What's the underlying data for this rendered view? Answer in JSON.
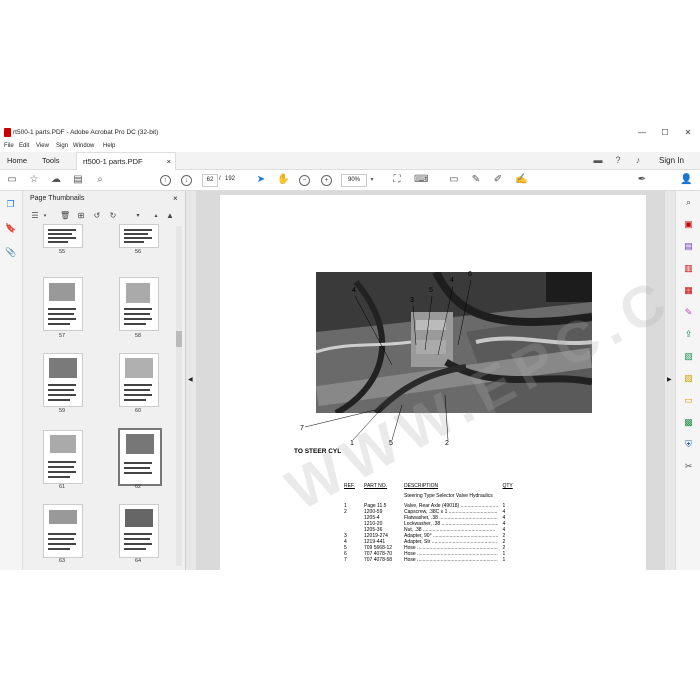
{
  "window": {
    "title": "rt500-1 parts.PDF - Adobe Acrobat Pro DC (32-bit)",
    "controls": [
      "—",
      "☐",
      "✕"
    ]
  },
  "menu": [
    "File",
    "Edit",
    "View",
    "Sign",
    "Window",
    "Help"
  ],
  "tabs": {
    "home": "Home",
    "tools": "Tools",
    "document": "rt500-1 parts.PDF",
    "close": "×",
    "sign_in": "Sign In"
  },
  "toolbar": {
    "current_page": "62",
    "page_separator": "/",
    "total_pages": "192",
    "zoom": "90%"
  },
  "panel": {
    "title": "Page Thumbnails",
    "close": "×",
    "thumbnails": [
      {
        "label": "55"
      },
      {
        "label": "56"
      },
      {
        "label": "57"
      },
      {
        "label": "58"
      },
      {
        "label": "59"
      },
      {
        "label": "60"
      },
      {
        "label": "61"
      },
      {
        "label": "62"
      },
      {
        "label": "63"
      },
      {
        "label": "64"
      }
    ]
  },
  "document": {
    "callouts": [
      "4",
      "3",
      "5",
      "4",
      "6",
      "7",
      "1",
      "5",
      "2"
    ],
    "caption": "TO STEER CYL",
    "table": {
      "headers": [
        "REF.",
        "PART NO.",
        "DESCRIPTION",
        "QTY"
      ],
      "title": "Steering Type Selector Valve Hydraulics",
      "rows": [
        [
          "1",
          "Page 11.5",
          "Valve, Rear Axle (49018) ...........................",
          "1"
        ],
        [
          "2",
          "1200-59",
          "Capscrew, .38C x 1 ...................................",
          "4"
        ],
        [
          "",
          "1205-4",
          "Flatwasher, .38 ..........................................",
          "4"
        ],
        [
          "",
          "1210-20",
          "Lockwasher, .38 .........................................",
          "4"
        ],
        [
          "",
          "1205-36",
          "Nut, .38 ....................................................",
          "4"
        ],
        [
          "3",
          "12019-274",
          "Adapter, 90° ...............................................",
          "2"
        ],
        [
          "4",
          "1219-441",
          "Adapter, Str ...............................................",
          "2"
        ],
        [
          "5",
          "709 5668-12",
          "Hose ..........................................................",
          "2"
        ],
        [
          "6",
          "707 4078-70",
          "Hose ..........................................................",
          "1"
        ],
        [
          "7",
          "707 4078-58",
          "Hose ..........................................................",
          "1"
        ]
      ]
    },
    "watermark": "WWW.EPC.COM"
  },
  "colors": {
    "accent": "#1473e6",
    "pdf_red": "#cc0000"
  }
}
